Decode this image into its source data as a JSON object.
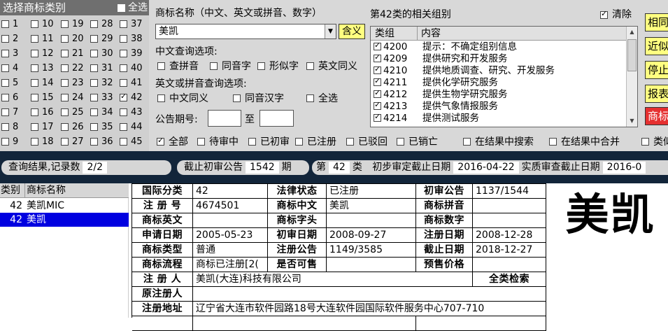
{
  "category_panel": {
    "title": "选择商标类别",
    "select_all": "全选",
    "categories": [
      "1",
      "10",
      "19",
      "28",
      "37",
      "2",
      "11",
      "20",
      "29",
      "38",
      "3",
      "12",
      "21",
      "30",
      "39",
      "4",
      "13",
      "22",
      "31",
      "40",
      "5",
      "14",
      "23",
      "32",
      "41",
      "6",
      "15",
      "24",
      "33",
      "42",
      "7",
      "16",
      "25",
      "34",
      "43",
      "8",
      "17",
      "26",
      "35",
      "44",
      "9",
      "18",
      "27",
      "36",
      "45"
    ],
    "checked": [
      "42"
    ]
  },
  "search": {
    "name_label": "商标名称（中文、英文或拼音、数字）",
    "name_value": "美凯",
    "meaning_button": "含义",
    "cn_options_label": "中文查询选项:",
    "cn_options": [
      "查拼音",
      "同音字",
      "形似字",
      "英文同义"
    ],
    "en_options_label": "英文或拼音查询选项:",
    "en_options": [
      "中文同义",
      "同音汉字",
      "全选"
    ],
    "announce_label": "公告期号:",
    "announce_to": "至"
  },
  "groups": {
    "title": "第42类的相关组别",
    "clear_label": "清除",
    "clear_checked": true,
    "col_group": "类组",
    "col_content": "内容",
    "rows": [
      {
        "code": "4200",
        "text": "提示：不确定组别信息"
      },
      {
        "code": "4209",
        "text": "提供研究和开发服务"
      },
      {
        "code": "4210",
        "text": "提供地质调查、研究、开发服务"
      },
      {
        "code": "4211",
        "text": "提供化学研究服务"
      },
      {
        "code": "4212",
        "text": "提供生物学研究服务"
      },
      {
        "code": "4213",
        "text": "提供气象情报服务"
      },
      {
        "code": "4214",
        "text": "提供测试服务"
      }
    ]
  },
  "side_buttons": [
    "相同",
    "近似",
    "停止",
    "报表",
    "商标"
  ],
  "status_filters": {
    "items": [
      "全部",
      "待审中",
      "已初审",
      "已注册",
      "已驳回",
      "已销亡"
    ],
    "checked": [
      "全部"
    ],
    "in_results_search": "在结果中搜索",
    "in_results_merge": "在结果中合并",
    "trailing": "类似"
  },
  "info_bar": {
    "result_label": "查询结果,记录数",
    "result_count": "2/2",
    "deadline_label": "截止初审公告",
    "deadline_value": "1542",
    "deadline_unit": "期",
    "class_prefix": "第",
    "class_value": "42",
    "class_suffix": "类",
    "prelim_label": "初步审定截止日期",
    "prelim_value": "2016-04-22",
    "exam_label": "实质审查截止日期",
    "exam_value": "2016-0"
  },
  "results": {
    "col_class": "类别",
    "col_name": "商标名称",
    "rows": [
      {
        "cls": "42",
        "name": "美凯MIC",
        "selected": false
      },
      {
        "cls": "42",
        "name": "美凯",
        "selected": true
      }
    ]
  },
  "detail": {
    "intl_class_label": "国际分类",
    "intl_class": "42",
    "legal_status_label": "法律状态",
    "legal_status": "已注册",
    "prelim_ann_label": "初审公告",
    "prelim_ann": "1137/1544",
    "reg_no_label": "注 册 号",
    "reg_no": "4674501",
    "cn_name_label": "商标中文",
    "cn_name": "美凯",
    "pinyin_label": "商标拼音",
    "pinyin": "",
    "en_name_label": "商标英文",
    "en_name": "",
    "header_label": "商标字头",
    "header": "",
    "digits_label": "商标数字",
    "digits": "",
    "apply_date_label": "申请日期",
    "apply_date": "2005-05-23",
    "prelim_date_label": "初审日期",
    "prelim_date": "2008-09-27",
    "reg_date_label": "注册日期",
    "reg_date": "2008-12-28",
    "type_label": "商标类型",
    "type": "普通",
    "reg_ann_label": "注册公告",
    "reg_ann": "1149/3585",
    "expiry_label": "截止日期",
    "expiry": "2018-12-27",
    "flow_label": "商标流程",
    "flow": "商标已注册[2(",
    "for_sale_label": "是否可售",
    "for_sale": "",
    "presale_label": "预售价格",
    "presale": "",
    "registrant_label": "注 册 人",
    "registrant": "美凯(大连)科技有限公司",
    "all_search_label": "全类检索",
    "orig_registrant_label": "原注册人",
    "orig_registrant": "",
    "address_label": "注册地址",
    "address": "辽宁省大连市软件园路18号大连软件园国际软件服务中心707-710"
  },
  "big_name": "美凯"
}
